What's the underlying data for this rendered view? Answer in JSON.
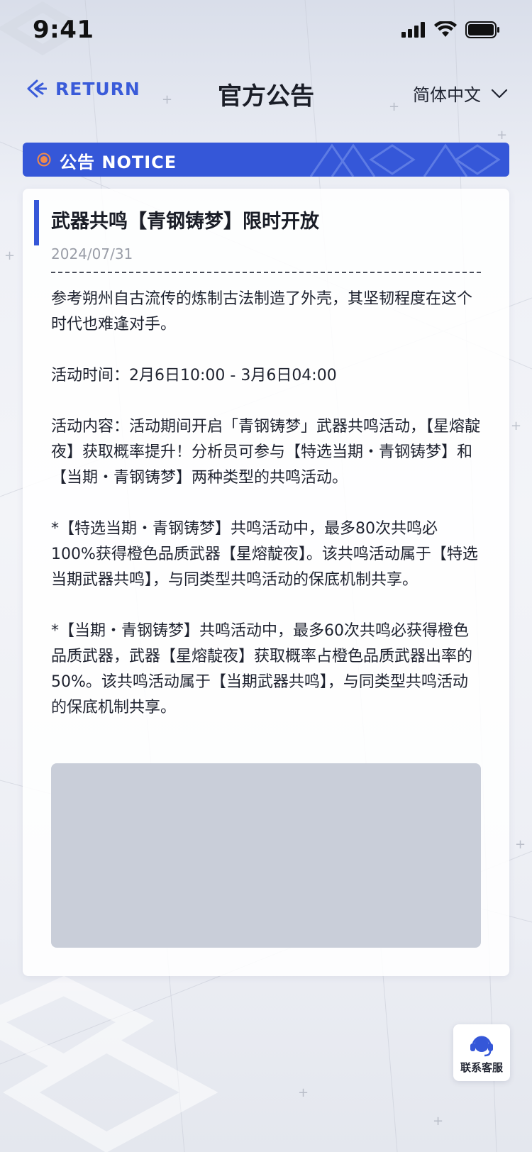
{
  "status_bar": {
    "time": "9:41"
  },
  "nav": {
    "return_label": "RETURN",
    "title": "官方公告",
    "language": "简体中文"
  },
  "notice_bar": {
    "label": "公告 NOTICE"
  },
  "article": {
    "title": "武器共鸣【青钢铸梦】限时开放",
    "date": "2024/07/31",
    "paragraphs": [
      "参考朔州自古流传的炼制古法制造了外壳，其坚韧程度在这个时代也难逢对手。",
      "活动时间：2月6日10:00 - 3月6日04:00",
      "活动内容：活动期间开启「青钢铸梦」武器共鸣活动，【星熔靛夜】获取概率提升！分析员可参与【特选当期・青钢铸梦】和【当期・青钢铸梦】两种类型的共鸣活动。",
      "*【特选当期・青钢铸梦】共鸣活动中，最多80次共鸣必100%获得橙色品质武器【星熔靛夜】。该共鸣活动属于【特选当期武器共鸣】，与同类型共鸣活动的保底机制共享。",
      "*【当期・青钢铸梦】共鸣活动中，最多60次共鸣必获得橙色品质武器，武器【星熔靛夜】获取概率占橙色品质武器出率的50%。该共鸣活动属于【当期武器共鸣】，与同类型共鸣活动的保底机制共享。"
    ]
  },
  "support": {
    "label": "联系客服"
  },
  "colors": {
    "accent": "#3557d8",
    "notice_dot": "#f08a4b",
    "image_placeholder": "#c9ced9"
  },
  "icons": {
    "back": "back-arrow-icon",
    "language_dropdown": "chevron-down-icon",
    "notice": "notice-dot-icon",
    "support": "headset-icon",
    "signal": "signal-icon",
    "wifi": "wifi-icon",
    "battery": "battery-icon"
  }
}
